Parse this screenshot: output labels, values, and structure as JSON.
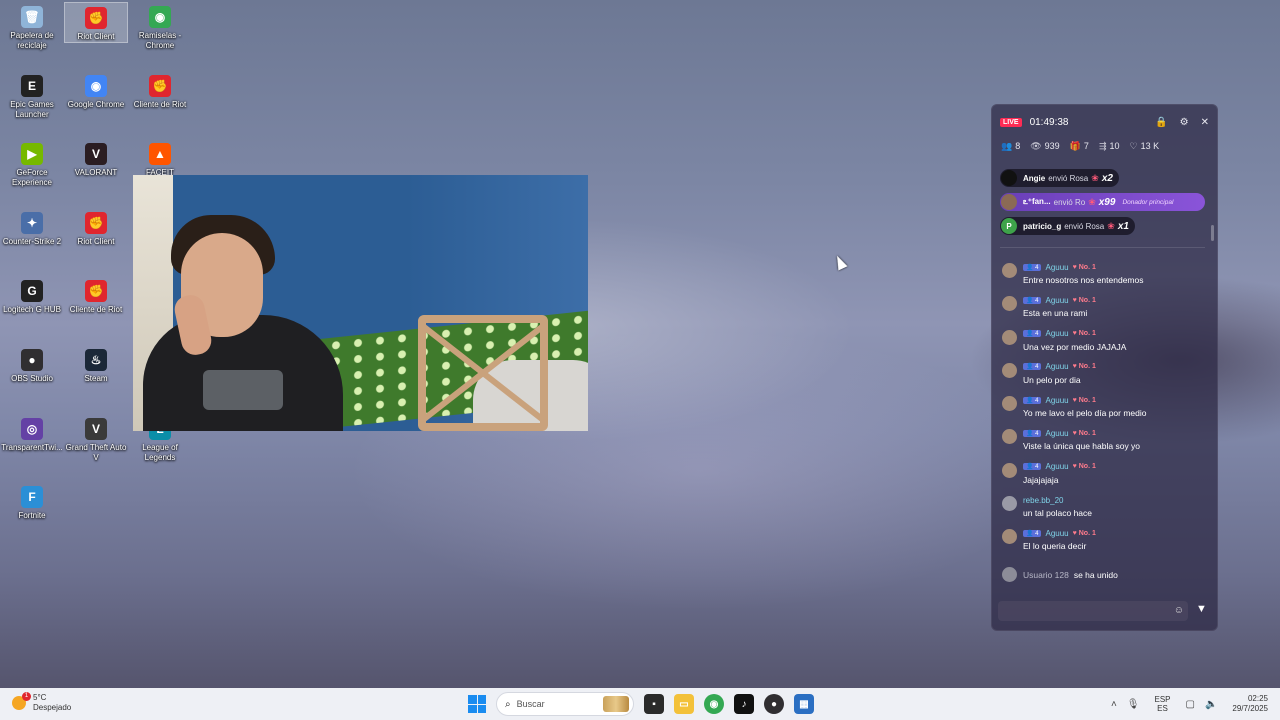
{
  "desktop": {
    "icons": [
      {
        "label": "Papelera de reciclaje",
        "glyph": "🗑",
        "color": "#8fb4d8"
      },
      {
        "label": "Riot Client",
        "glyph": "✊",
        "color": "#e0262e"
      },
      {
        "label": "Ramiselas - Chrome",
        "glyph": "◉",
        "color": "#34a853"
      },
      {
        "label": "Epic Games Launcher",
        "glyph": "E",
        "color": "#222222"
      },
      {
        "label": "Google Chrome",
        "glyph": "◉",
        "color": "#4285f4"
      },
      {
        "label": "Cliente de Riot",
        "glyph": "✊",
        "color": "#e0262e"
      },
      {
        "label": "GeForce Experience",
        "glyph": "▶",
        "color": "#76b900"
      },
      {
        "label": "VALORANT",
        "glyph": "V",
        "color": "#2b1d22"
      },
      {
        "label": "FACEIT",
        "glyph": "▲",
        "color": "#ff5500"
      },
      {
        "label": "Counter-Strike 2",
        "glyph": "✦",
        "color": "#4a6ea8"
      },
      {
        "label": "Riot Client",
        "glyph": "✊",
        "color": "#e0262e"
      },
      {
        "label": "Logitech G HUB",
        "glyph": "G",
        "color": "#222222"
      },
      {
        "label": "Cliente de Riot",
        "glyph": "✊",
        "color": "#e0262e"
      },
      {
        "label": "OBS Studio",
        "glyph": "●",
        "color": "#302e31"
      },
      {
        "label": "Steam",
        "glyph": "♨",
        "color": "#1b2838"
      },
      {
        "label": "TransparentTwi...",
        "glyph": "◎",
        "color": "#6441a5"
      },
      {
        "label": "Grand Theft Auto V",
        "glyph": "V",
        "color": "#3a3a3a"
      },
      {
        "label": "League of Legends",
        "glyph": "L",
        "color": "#0a8ea8"
      },
      {
        "label": "Fortnite",
        "glyph": "F",
        "color": "#2b8fd6"
      }
    ]
  },
  "live_panel": {
    "badge": "LIVE",
    "timer": "01:49:38",
    "stats": {
      "viewers_icon": "8",
      "views": "939",
      "gifts": "7",
      "shares": "10",
      "likes": "13 K"
    },
    "gifts": [
      {
        "user": "Angie",
        "action": "envió Rosa",
        "mult": "x2",
        "avatar": "",
        "avatar_color": "#111111"
      },
      {
        "user": "ఽ⁺fan...",
        "action": "envió Ro",
        "mult": "x99",
        "donor": "Donador principal",
        "avatar": "",
        "avatar_color": "#8b6a55"
      },
      {
        "user": "patricio_g",
        "action": "envió Rosa",
        "mult": "x1",
        "avatar": "P",
        "avatar_color": "#3ea34a"
      }
    ],
    "chat": [
      {
        "name": "Aguuu",
        "level": "4",
        "rank": "No. 1",
        "text": "Entre nosotros nos entendemos"
      },
      {
        "name": "Aguuu",
        "level": "4",
        "rank": "No. 1",
        "text": "Esta en una rami"
      },
      {
        "name": "Aguuu",
        "level": "4",
        "rank": "No. 1",
        "text": "Una vez por medio JAJAJA"
      },
      {
        "name": "Aguuu",
        "level": "4",
        "rank": "No. 1",
        "text": "Un pelo por dia"
      },
      {
        "name": "Aguuu",
        "level": "4",
        "rank": "No. 1",
        "text": "Yo me lavo el pelo día por medio"
      },
      {
        "name": "Aguuu",
        "level": "4",
        "rank": "No. 1",
        "text": "Viste la única que habla soy yo"
      },
      {
        "name": "Aguuu",
        "level": "4",
        "rank": "No. 1",
        "text": "Jajajajaja"
      },
      {
        "name": "rebe.bb_20",
        "level": "",
        "rank": "",
        "text": "un tal polaco hace"
      },
      {
        "name": "Aguuu",
        "level": "4",
        "rank": "No. 1",
        "text": "El lo queria decir"
      }
    ],
    "join": {
      "user": "Usuario 128",
      "text": "se ha unido"
    }
  },
  "taskbar": {
    "weather_temp": "5°C",
    "weather_desc": "Despejado",
    "search_placeholder": "Buscar",
    "lang1": "ESP",
    "lang2": "ES",
    "time": "02:25",
    "date": "29/7/2025"
  }
}
